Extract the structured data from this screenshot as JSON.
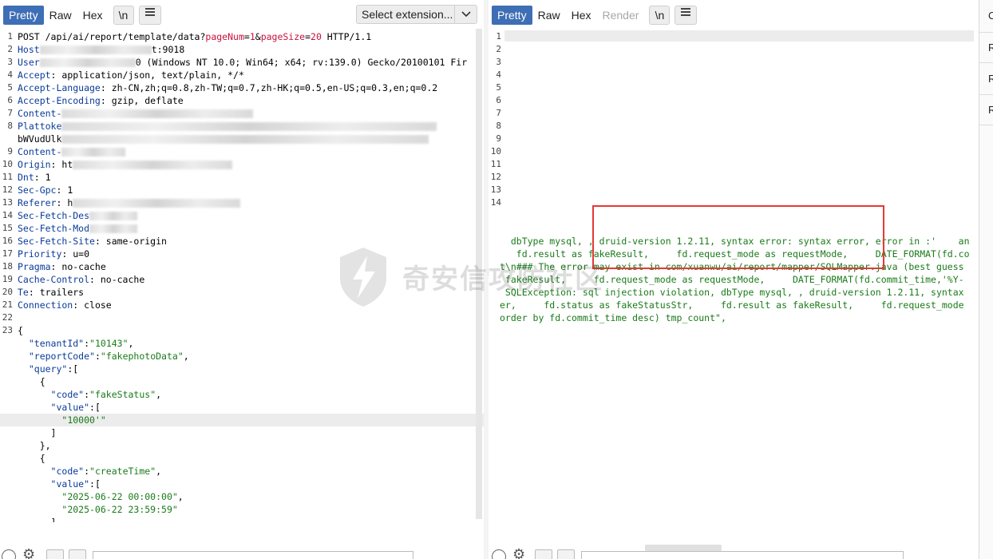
{
  "request": {
    "tabs": [
      {
        "label": "Pretty",
        "active": true
      },
      {
        "label": "Raw",
        "active": false
      },
      {
        "label": "Hex",
        "active": false
      }
    ],
    "newline_toggle": "\\n",
    "extension_select": "Select extension...",
    "lines": [
      {
        "n": "1",
        "parts": [
          [
            "method",
            "POST /api/ai/report/template/data?"
          ],
          [
            "param",
            "pageNum"
          ],
          [
            "method",
            "="
          ],
          [
            "param",
            "1"
          ],
          [
            "method",
            "&"
          ],
          [
            "param",
            "pageSize"
          ],
          [
            "method",
            "="
          ],
          [
            "param",
            "20"
          ],
          [
            "method",
            " HTTP/1.1"
          ]
        ]
      },
      {
        "n": "2",
        "parts": [
          [
            "hname",
            "Host"
          ],
          [
            "blur",
            "140"
          ],
          [
            "method",
            "t:9018"
          ]
        ]
      },
      {
        "n": "3",
        "parts": [
          [
            "hname",
            "User"
          ],
          [
            "blur",
            "120"
          ],
          [
            "method",
            "0 (Windows NT 10.0; Win64; x64; rv:139.0) Gecko/20100101 Fir"
          ]
        ]
      },
      {
        "n": "4",
        "parts": [
          [
            "hname",
            "Accept"
          ],
          [
            "method",
            ": application/json, text/plain, */*"
          ]
        ]
      },
      {
        "n": "5",
        "parts": [
          [
            "hname",
            "Accept-Language"
          ],
          [
            "method",
            ": zh-CN,zh;q=0.8,zh-TW;q=0.7,zh-HK;q=0.5,en-US;q=0.3,en;q=0.2"
          ]
        ]
      },
      {
        "n": "6",
        "parts": [
          [
            "hname",
            "Accept-Encoding"
          ],
          [
            "method",
            ": gzip, deflate"
          ]
        ]
      },
      {
        "n": "7",
        "parts": [
          [
            "hname",
            "Content-"
          ],
          [
            "blur",
            "240"
          ]
        ]
      },
      {
        "n": "8",
        "parts": [
          [
            "hname",
            "Plattoke"
          ],
          [
            "blur",
            "470"
          ]
        ]
      },
      {
        "n": "",
        "parts": [
          [
            "method",
            "bWVudUlk"
          ],
          [
            "blur",
            "460"
          ]
        ]
      },
      {
        "n": "9",
        "parts": [
          [
            "hname",
            "Content-"
          ],
          [
            "blur",
            "80"
          ]
        ]
      },
      {
        "n": "10",
        "parts": [
          [
            "hname",
            "Origin"
          ],
          [
            "method",
            ": ht"
          ],
          [
            "blur",
            "200"
          ]
        ]
      },
      {
        "n": "11",
        "parts": [
          [
            "hname",
            "Dnt"
          ],
          [
            "method",
            ": 1"
          ]
        ]
      },
      {
        "n": "12",
        "parts": [
          [
            "hname",
            "Sec-Gpc"
          ],
          [
            "method",
            ": 1"
          ]
        ]
      },
      {
        "n": "13",
        "parts": [
          [
            "hname",
            "Referer"
          ],
          [
            "method",
            ": h"
          ],
          [
            "blur",
            "210"
          ]
        ]
      },
      {
        "n": "14",
        "parts": [
          [
            "hname",
            "Sec-Fetch-Des"
          ],
          [
            "blur",
            "60"
          ]
        ]
      },
      {
        "n": "15",
        "parts": [
          [
            "hname",
            "Sec-Fetch-Mod"
          ],
          [
            "blur",
            "60"
          ]
        ]
      },
      {
        "n": "16",
        "parts": [
          [
            "hname",
            "Sec-Fetch-Site"
          ],
          [
            "method",
            ": same-origin"
          ]
        ]
      },
      {
        "n": "17",
        "parts": [
          [
            "hname",
            "Priority"
          ],
          [
            "method",
            ": u=0"
          ]
        ]
      },
      {
        "n": "18",
        "parts": [
          [
            "hname",
            "Pragma"
          ],
          [
            "method",
            ": no-cache"
          ]
        ]
      },
      {
        "n": "19",
        "parts": [
          [
            "hname",
            "Cache-Control"
          ],
          [
            "method",
            ": no-cache"
          ]
        ]
      },
      {
        "n": "20",
        "parts": [
          [
            "hname",
            "Te"
          ],
          [
            "method",
            ": trailers"
          ]
        ]
      },
      {
        "n": "21",
        "parts": [
          [
            "hname",
            "Connection"
          ],
          [
            "method",
            ": close"
          ]
        ]
      },
      {
        "n": "22",
        "parts": []
      },
      {
        "n": "23",
        "parts": [
          [
            "method",
            "{"
          ]
        ]
      },
      {
        "n": "",
        "parts": [
          [
            "method",
            "  "
          ],
          [
            "jkey",
            "\"tenantId\""
          ],
          [
            "method",
            ":"
          ],
          [
            "jstr",
            "\"10143\""
          ],
          [
            "method",
            ","
          ]
        ]
      },
      {
        "n": "",
        "parts": [
          [
            "method",
            "  "
          ],
          [
            "jkey",
            "\"reportCode\""
          ],
          [
            "method",
            ":"
          ],
          [
            "jstr",
            "\"fakephotoData\""
          ],
          [
            "method",
            ","
          ]
        ]
      },
      {
        "n": "",
        "parts": [
          [
            "method",
            "  "
          ],
          [
            "jkey",
            "\"query\""
          ],
          [
            "method",
            ":["
          ]
        ]
      },
      {
        "n": "",
        "parts": [
          [
            "method",
            "    {"
          ]
        ]
      },
      {
        "n": "",
        "parts": [
          [
            "method",
            "      "
          ],
          [
            "jkey",
            "\"code\""
          ],
          [
            "method",
            ":"
          ],
          [
            "jstr",
            "\"fakeStatus\""
          ],
          [
            "method",
            ","
          ]
        ]
      },
      {
        "n": "",
        "parts": [
          [
            "method",
            "      "
          ],
          [
            "jkey",
            "\"value\""
          ],
          [
            "method",
            ":["
          ]
        ]
      },
      {
        "n": "",
        "hl": true,
        "parts": [
          [
            "method",
            "        "
          ],
          [
            "jstr",
            "\"10000'\""
          ]
        ]
      },
      {
        "n": "",
        "parts": [
          [
            "method",
            "      ]"
          ]
        ]
      },
      {
        "n": "",
        "parts": [
          [
            "method",
            "    },"
          ]
        ]
      },
      {
        "n": "",
        "parts": [
          [
            "method",
            "    {"
          ]
        ]
      },
      {
        "n": "",
        "parts": [
          [
            "method",
            "      "
          ],
          [
            "jkey",
            "\"code\""
          ],
          [
            "method",
            ":"
          ],
          [
            "jstr",
            "\"createTime\""
          ],
          [
            "method",
            ","
          ]
        ]
      },
      {
        "n": "",
        "parts": [
          [
            "method",
            "      "
          ],
          [
            "jkey",
            "\"value\""
          ],
          [
            "method",
            ":["
          ]
        ]
      },
      {
        "n": "",
        "parts": [
          [
            "method",
            "        "
          ],
          [
            "jstr",
            "\"2025-06-22 00:00:00\""
          ],
          [
            "method",
            ","
          ]
        ]
      },
      {
        "n": "",
        "parts": [
          [
            "method",
            "        "
          ],
          [
            "jstr",
            "\"2025-06-22 23:59:59\""
          ]
        ]
      },
      {
        "n": "",
        "parts": [
          [
            "method",
            "      ]"
          ]
        ]
      },
      {
        "n": "",
        "parts": [
          [
            "method",
            "    }"
          ]
        ]
      }
    ]
  },
  "response": {
    "tabs": [
      {
        "label": "Pretty",
        "active": true,
        "disabled": false
      },
      {
        "label": "Raw",
        "active": false,
        "disabled": false
      },
      {
        "label": "Hex",
        "active": false,
        "disabled": false
      },
      {
        "label": "Render",
        "active": false,
        "disabled": true
      }
    ],
    "newline_toggle": "\\n",
    "line_numbers": [
      "1",
      "2",
      "3",
      "4",
      "5",
      "6",
      "7",
      "8",
      "9",
      "10",
      "11",
      "12",
      "13",
      "14"
    ],
    "body_lines": [
      "  dbType mysql, , druid-version 1.2.11, syntax error: syntax error, error in :'    an",
      "   fd.result as fakeResult,     fd.request_mode as requestMode,     DATE_FORMAT(fd.co",
      "t\\n### The error may exist in com/xuanwu/ai/report/mapper/SQLMapper.java (best guess",
      " fakeResult,     fd.request_mode as requestMode,     DATE_FORMAT(fd.commit_time,'%Y-",
      " SQLException: sql injection violation, dbType mysql, , druid-version 1.2.11, syntax ",
      "er,     fd.status as fakeStatusStr,     fd.result as fakeResult,     fd.request_mode",
      "order by fd.commit_time desc) tmp_count\","
    ]
  },
  "watermark": {
    "text": "奇安信攻防社区"
  },
  "side_panel": {
    "items": [
      "C",
      "R",
      "R",
      "R"
    ]
  },
  "colors": {
    "accent": "#3e6eb5",
    "highlight_box": "#e53935",
    "json_string": "#1a7a1a",
    "header_name": "#0a3b99",
    "param": "#c8103c"
  }
}
